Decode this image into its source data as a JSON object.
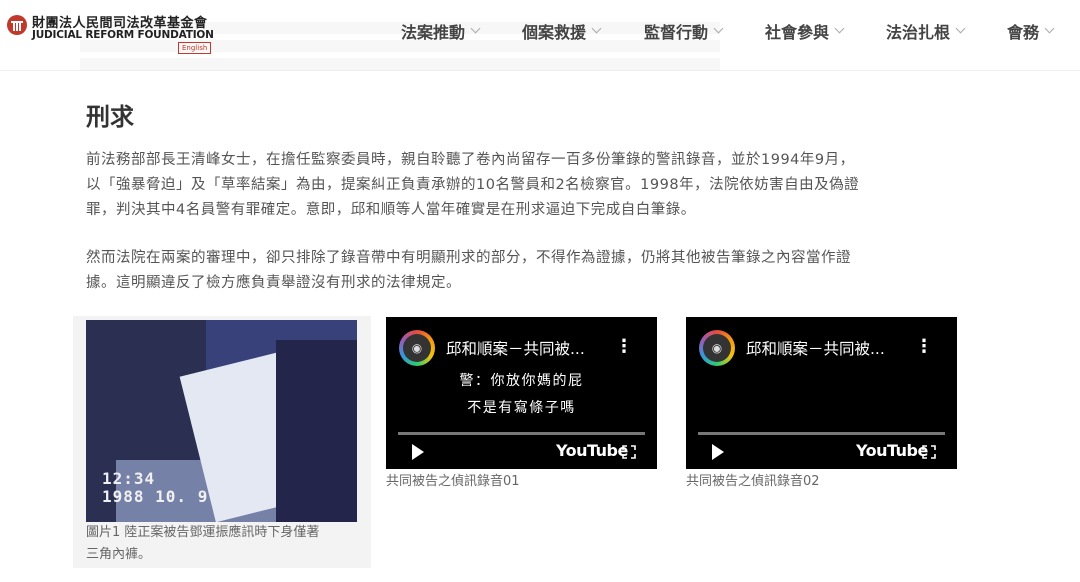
{
  "header": {
    "logo_zh": "財團法人民間司法改革基金會",
    "logo_en": "JUDICIAL REFORM FOUNDATION",
    "logo_lang": "English",
    "nav": [
      "法案推動",
      "個案救援",
      "監督行動",
      "社會參與",
      "法治扎根",
      "會務"
    ]
  },
  "article": {
    "title": "刑求",
    "para1": [
      "前法務部部長王清峰女士，在擔任監察委員時，親自聆聽了卷內尚留存一百多份筆錄的警訊錄音，並於1994年9月，",
      "以「強暴脅迫」及「草率結案」為由，提案糾正負責承辦的10名警員和2名檢察官。1998年，法院依妨害自由及偽證",
      "罪，判決其中4名員警有罪確定。意即，邱和順等人當年確實是在刑求逼迫下完成自白筆錄。"
    ],
    "para2": [
      "然而法院在兩案的審理中，卻只排除了錄音帶中有明顯刑求的部分，不得作為證據，仍將其他被告筆錄之內容當作證",
      "據。這明顯違反了檢方應負責舉證沒有刑求的法律規定。"
    ]
  },
  "figure": {
    "stamp_time": "12:34",
    "stamp_date": "1988 10. 9",
    "caption": [
      "圖片1 陸正案被告鄧運振應訊時下身僅著",
      "三角內褲。"
    ]
  },
  "videos": [
    {
      "title": "邱和順案－共同被...",
      "subtitles": [
        "警：你放你媽的屁",
        "不是有寫條子嗎"
      ],
      "brand": "YouTube",
      "caption": "共同被告之偵訊錄音01"
    },
    {
      "title": "邱和順案－共同被...",
      "subtitles": [],
      "brand": "YouTube",
      "caption": "共同被告之偵訊錄音02"
    }
  ],
  "colors": {
    "logo_red": "#c0392b",
    "nav_text": "#444444",
    "video_bg": "#000000"
  }
}
